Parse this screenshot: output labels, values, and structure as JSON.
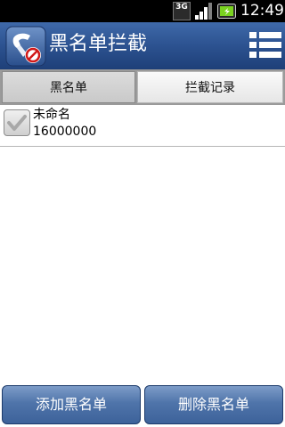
{
  "status_bar": {
    "network": "3G",
    "time": "12:49"
  },
  "title_bar": {
    "title": "黑名单拦截"
  },
  "tabs": [
    {
      "label": "黑名单",
      "selected": true
    },
    {
      "label": "拦截记录",
      "selected": false
    }
  ],
  "blacklist": [
    {
      "name": "未命名",
      "number": "16000000",
      "checked": true
    }
  ],
  "bottom_buttons": {
    "add_label": "添加黑名单",
    "delete_label": "删除黑名单"
  },
  "colors": {
    "title_bar": "#2c5290",
    "button": "#4f74aa",
    "battery": "#7ad320"
  }
}
